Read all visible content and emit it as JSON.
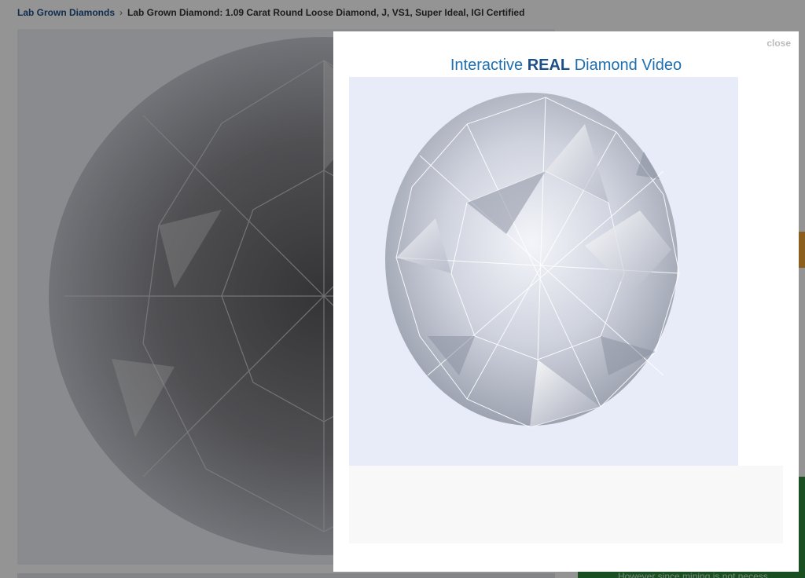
{
  "breadcrumb": {
    "root": "Lab Grown Diamonds",
    "separator": "›",
    "current": "Lab Grown Diamond: 1.09 Carat Round Loose Diamond, J, VS1, Super Ideal, IGI Certified"
  },
  "modal": {
    "close_label": "close",
    "title_prefix": "Interactive ",
    "title_bold": "REAL",
    "title_suffix": " Diamond Video"
  },
  "background": {
    "green_note": "However since mining is not necess"
  },
  "colors": {
    "link_blue": "#1d4f8a",
    "title_blue": "#1d6fb0",
    "accent_orange": "#f0a232",
    "accent_green": "#2e8a3a"
  }
}
